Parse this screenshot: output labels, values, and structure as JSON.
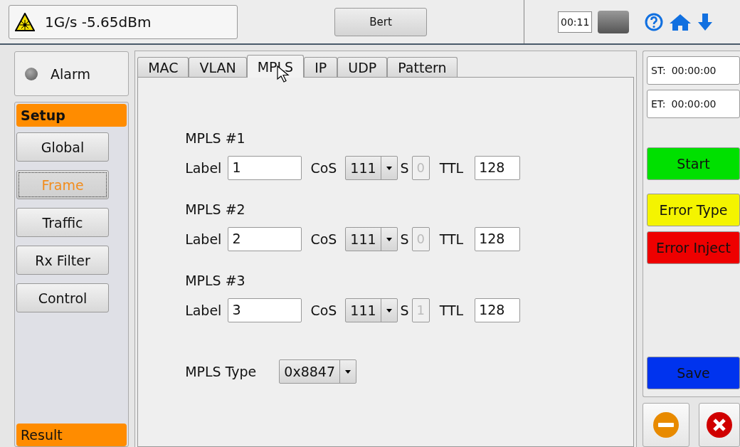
{
  "status": {
    "text": "1G/s -5.65dBm"
  },
  "mode_button": "Bert",
  "timer": "00:11",
  "alarm": {
    "label": "Alarm",
    "on": false
  },
  "setup_header": "Setup",
  "nav": [
    {
      "label": "Global",
      "selected": false
    },
    {
      "label": "Frame",
      "selected": true
    },
    {
      "label": "Traffic",
      "selected": false
    },
    {
      "label": "Rx Filter",
      "selected": false
    },
    {
      "label": "Control",
      "selected": false
    }
  ],
  "result_header": "Result",
  "tabs": [
    {
      "label": "MAC",
      "selected": false
    },
    {
      "label": "VLAN",
      "selected": false
    },
    {
      "label": "MPLS",
      "selected": true
    },
    {
      "label": "IP",
      "selected": false
    },
    {
      "label": "UDP",
      "selected": false
    },
    {
      "label": "Pattern",
      "selected": false
    }
  ],
  "mpls": [
    {
      "heading": "MPLS #1",
      "label_text": "Label",
      "label_value": "1",
      "cos_text": "CoS",
      "cos_value": "111",
      "s_text": "S",
      "s_value": "0",
      "s_disabled": true,
      "ttl_text": "TTL",
      "ttl_value": "128"
    },
    {
      "heading": "MPLS #2",
      "label_text": "Label",
      "label_value": "2",
      "cos_text": "CoS",
      "cos_value": "111",
      "s_text": "S",
      "s_value": "0",
      "s_disabled": true,
      "ttl_text": "TTL",
      "ttl_value": "128"
    },
    {
      "heading": "MPLS #3",
      "label_text": "Label",
      "label_value": "3",
      "cos_text": "CoS",
      "cos_value": "111",
      "s_text": "S",
      "s_value": "1",
      "s_disabled": true,
      "ttl_text": "TTL",
      "ttl_value": "128"
    }
  ],
  "mpls_type": {
    "label": "MPLS Type",
    "value": "0x8847"
  },
  "times": [
    {
      "label": "ST:",
      "value": "00:00:00"
    },
    {
      "label": "ET:",
      "value": "00:00:00"
    }
  ],
  "actions": [
    {
      "label": "Start",
      "color": "#00e000"
    },
    {
      "label": "Error Type",
      "color": "#f4f400"
    },
    {
      "label": "Error Inject",
      "color": "#ee0000"
    }
  ],
  "save": {
    "label": "Save",
    "color": "#0033ee"
  }
}
